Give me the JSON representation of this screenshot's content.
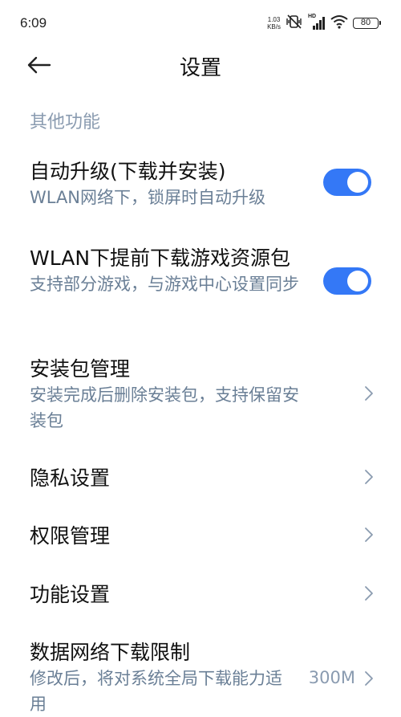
{
  "status_bar": {
    "time": "6:09",
    "net_speed_value": "1.03",
    "net_speed_unit": "KB/s",
    "hd_label": "HD",
    "battery": "80"
  },
  "header": {
    "title": "设置"
  },
  "section": {
    "title": "其他功能"
  },
  "items": [
    {
      "title": "自动升级(下载并安装)",
      "desc": "WLAN网络下，锁屏时自动升级",
      "toggle": true
    },
    {
      "title": "WLAN下提前下载游戏资源包",
      "desc": "支持部分游戏，与游戏中心设置同步",
      "toggle": true
    },
    {
      "title": "安装包管理",
      "desc": "安装完成后删除安装包，支持保留安装包"
    },
    {
      "title": "隐私设置"
    },
    {
      "title": "权限管理"
    },
    {
      "title": "功能设置"
    },
    {
      "title": "数据网络下载限制",
      "desc": "修改后，将对系统全局下载能力适用",
      "value": "300M"
    }
  ],
  "colors": {
    "accent": "#3478f6",
    "secondary_text": "#6a7f96",
    "section_text": "#8a9bb0"
  }
}
